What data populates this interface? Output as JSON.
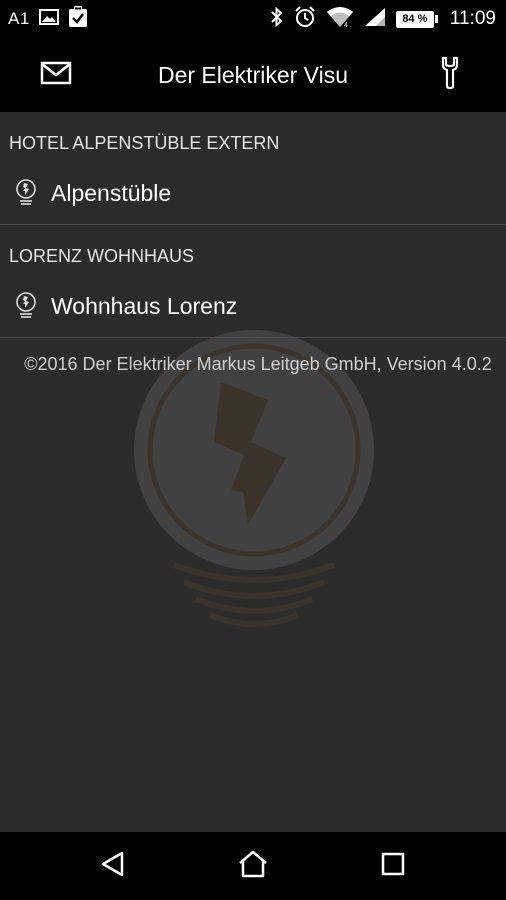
{
  "status_bar": {
    "carrier": "A1",
    "battery_text": "84 %",
    "time": "11:09",
    "icons": [
      "image-icon",
      "clipboard-check-icon",
      "bluetooth-icon",
      "alarm-icon",
      "wifi-icon",
      "signal-icon",
      "battery-icon"
    ]
  },
  "app_bar": {
    "title": "Der Elektriker Visu",
    "left_icon": "mail-icon",
    "right_icon": "wrench-icon"
  },
  "sections": [
    {
      "header": "HOTEL ALPENSTÜBLE EXTERN",
      "items": [
        {
          "label": "Alpenstüble",
          "icon": "lightbulb-icon"
        }
      ]
    },
    {
      "header": "LORENZ WOHNHAUS",
      "items": [
        {
          "label": "Wohnhaus Lorenz",
          "icon": "lightbulb-icon"
        }
      ]
    }
  ],
  "footer": {
    "copyright": "©2016 Der Elektriker Markus Leitgeb GmbH, Version 4.0.2"
  },
  "nav_bar": {
    "icons": [
      "back-icon",
      "home-icon",
      "recent-apps-icon"
    ]
  },
  "colors": {
    "background": "#2b2b2b",
    "bars": "#000000",
    "watermark_accent": "#c87a1e",
    "divider": "#4a4a4a"
  }
}
